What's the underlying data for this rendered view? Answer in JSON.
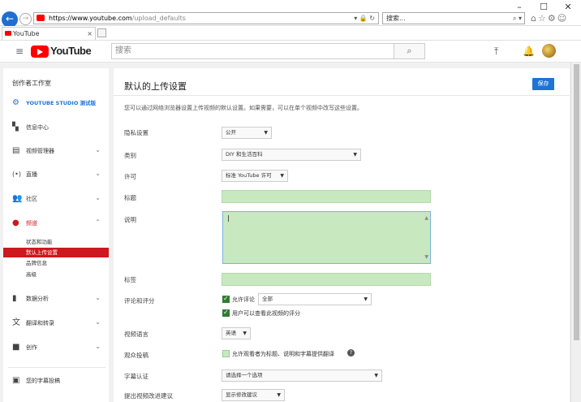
{
  "browser": {
    "address_domain": "https://www.youtube.com",
    "address_path": "/upload_defaults",
    "search_placeholder": "搜索...",
    "tab_title": "YouTube"
  },
  "header": {
    "logo_text": "YouTube",
    "search_placeholder": "搜索"
  },
  "sidebar": {
    "title": "创作者工作室",
    "studio_beta": "YOUTUBE STUDIO 测试版",
    "items": [
      {
        "label": "信息中心"
      },
      {
        "label": "视频管理器"
      },
      {
        "label": "直播"
      },
      {
        "label": "社区"
      },
      {
        "label": "频道"
      }
    ],
    "channel_sub": [
      "状态和功能",
      "默认上传设置",
      "品牌信息",
      "高级"
    ],
    "items2": [
      {
        "label": "数据分析"
      },
      {
        "label": "翻译和转录"
      },
      {
        "label": "创作"
      },
      {
        "label": "您的字幕投稿"
      }
    ]
  },
  "main": {
    "title": "默认的上传设置",
    "save_label": "保存",
    "intro": "您可以通过网络浏览器设置上传视频的默认设置。如果需要，可以在单个视频中改写这些设置。",
    "privacy_label": "隐私设置",
    "privacy_value": "公开",
    "category_label": "类别",
    "category_value": "DIY 和生活百科",
    "license_label": "许可",
    "license_value": "标准 YouTube 许可",
    "title_label": "标题",
    "description_label": "说明",
    "tags_label": "标签",
    "comments_label": "评论和评分",
    "allow_comments": "允许评论",
    "comments_value": "全部",
    "view_ratings": "用户可以查看此视频的评分",
    "video_language_label": "视频语言",
    "video_language_value": "英语",
    "community_label": "观众投稿",
    "community_text": "允许观看者为标题、说明和字幕提供翻译",
    "caption_cert_label": "字幕认证",
    "caption_cert_value": "请选择一个选项",
    "suggest_label": "提出视频改进建议",
    "suggest_value": "显示修改建议"
  }
}
